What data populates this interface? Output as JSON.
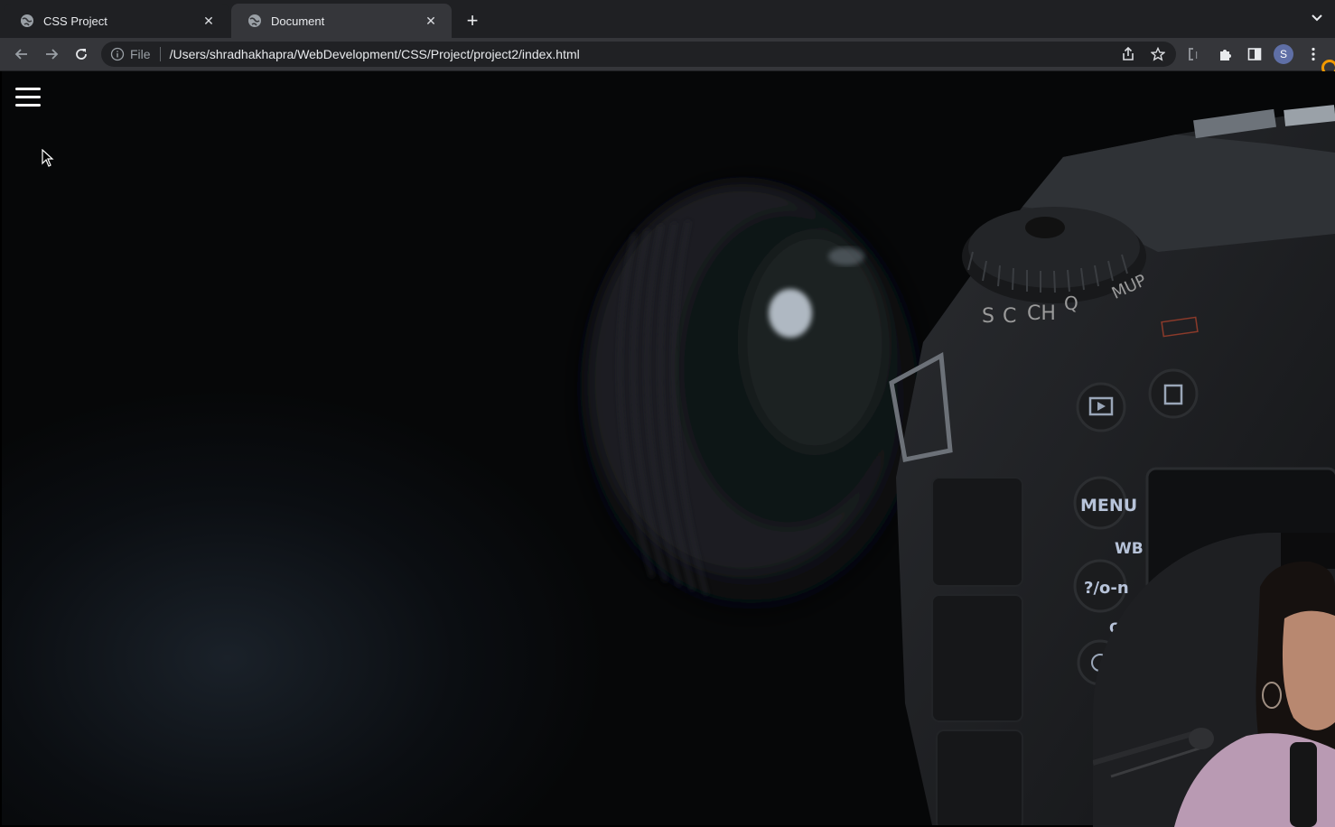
{
  "browser": {
    "tabs": [
      {
        "title": "CSS Project",
        "active": false
      },
      {
        "title": "Document",
        "active": true
      }
    ],
    "new_tab_label": "+",
    "omnibox": {
      "scheme_label": "File",
      "url": "/Users/shradhakhapra/WebDevelopment/CSS/Project/project2/index.html"
    },
    "profile_initial": "S",
    "colors": {
      "tabstrip": "#1f2023",
      "toolbar": "#35363a",
      "omnibox": "#202124",
      "accent": "#f29900"
    }
  },
  "icons": {
    "tab_favicon": "globe-icon",
    "close": "close-icon",
    "back": "back-arrow-icon",
    "forward": "forward-arrow-icon",
    "reload": "reload-icon",
    "info": "info-icon",
    "share": "share-icon",
    "bookmark": "star-icon",
    "extensions": "puzzle-icon",
    "side_panel": "side-panel-icon",
    "menu": "kebab-menu-icon",
    "tab_search": "chevron-down-icon",
    "page_menu": "hamburger-menu-icon"
  },
  "page": {
    "hero_image": "camera-lens-photo",
    "camera_text": {
      "dial_modes": [
        "S",
        "C",
        "CH",
        "Q",
        "MUP"
      ],
      "menu_button": "MENU",
      "wb_label": "WB",
      "help_button": "?/o-n",
      "qual_label": "QUA"
    }
  }
}
